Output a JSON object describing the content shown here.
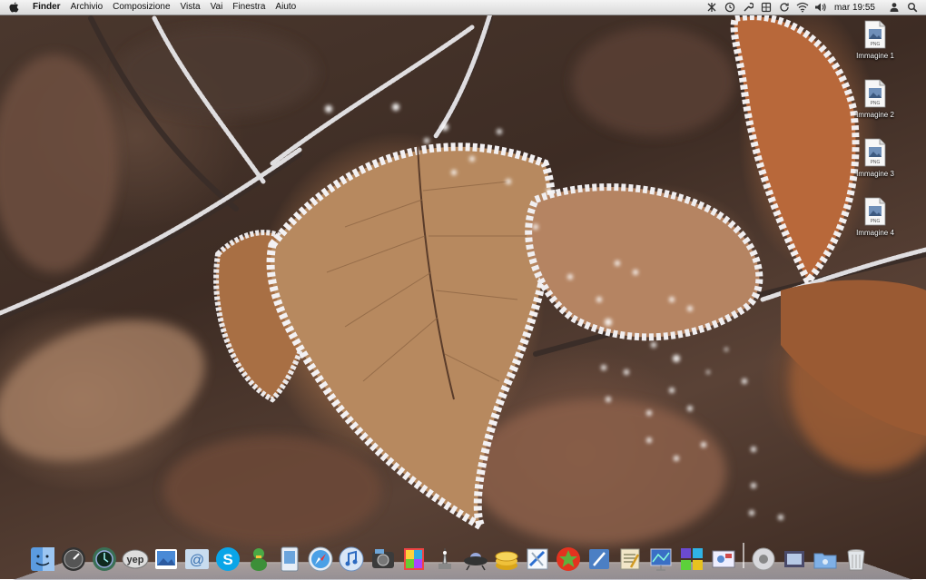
{
  "menubar": {
    "app_name": "Finder",
    "items": [
      "Archivio",
      "Composizione",
      "Vista",
      "Vai",
      "Finestra",
      "Aiuto"
    ],
    "status_icons": [
      "bluetooth-tool-icon",
      "time-machine-icon",
      "wrench-icon",
      "spaces-icon",
      "sync-icon",
      "wifi-icon",
      "volume-icon"
    ],
    "clock": "mar 19:55",
    "user_icon": "user-icon",
    "spotlight_icon": "spotlight-search-icon"
  },
  "desktop": {
    "files": [
      {
        "label": "Immagine 1",
        "icon": "png-document-icon"
      },
      {
        "label": "Immagine 2",
        "icon": "png-document-icon"
      },
      {
        "label": "Immagine 3",
        "icon": "png-document-icon"
      },
      {
        "label": "Immagine 4",
        "icon": "png-document-icon"
      }
    ],
    "doc_badge": "PNG"
  },
  "dock": {
    "items": [
      {
        "name": "finder",
        "icon": "finder-icon"
      },
      {
        "name": "dashboard",
        "icon": "dashboard-icon"
      },
      {
        "name": "time-machine",
        "icon": "time-machine-icon"
      },
      {
        "name": "yep",
        "icon": "yep-icon",
        "text": "yep"
      },
      {
        "name": "iphoto-library",
        "icon": "photo-icon"
      },
      {
        "name": "mail",
        "icon": "mail-icon"
      },
      {
        "name": "skype",
        "icon": "skype-icon"
      },
      {
        "name": "adium",
        "icon": "adium-duck-icon"
      },
      {
        "name": "preview",
        "icon": "preview-icon"
      },
      {
        "name": "safari",
        "icon": "safari-compass-icon"
      },
      {
        "name": "itunes",
        "icon": "itunes-icon"
      },
      {
        "name": "iphoto",
        "icon": "iphoto-camera-icon"
      },
      {
        "name": "photo-booth",
        "icon": "photo-booth-icon"
      },
      {
        "name": "automator",
        "icon": "automator-icon"
      },
      {
        "name": "ufo",
        "icon": "ufo-icon"
      },
      {
        "name": "coins",
        "icon": "coins-icon"
      },
      {
        "name": "xcode",
        "icon": "xcode-icon"
      },
      {
        "name": "growl",
        "icon": "red-star-icon"
      },
      {
        "name": "pen-tool",
        "icon": "pen-tool-icon"
      },
      {
        "name": "script-editor",
        "icon": "script-editor-icon"
      },
      {
        "name": "keynote",
        "icon": "keynote-icon"
      },
      {
        "name": "spaces",
        "icon": "spaces-grid-icon"
      },
      {
        "name": "screenshot",
        "icon": "screenshot-icon"
      },
      {
        "name": "system-prefs",
        "icon": "system-prefs-icon"
      },
      {
        "name": "downloads-stack",
        "icon": "stack-icon"
      },
      {
        "name": "documents-folder",
        "icon": "folder-icon"
      },
      {
        "name": "trash",
        "icon": "trash-icon"
      }
    ]
  }
}
